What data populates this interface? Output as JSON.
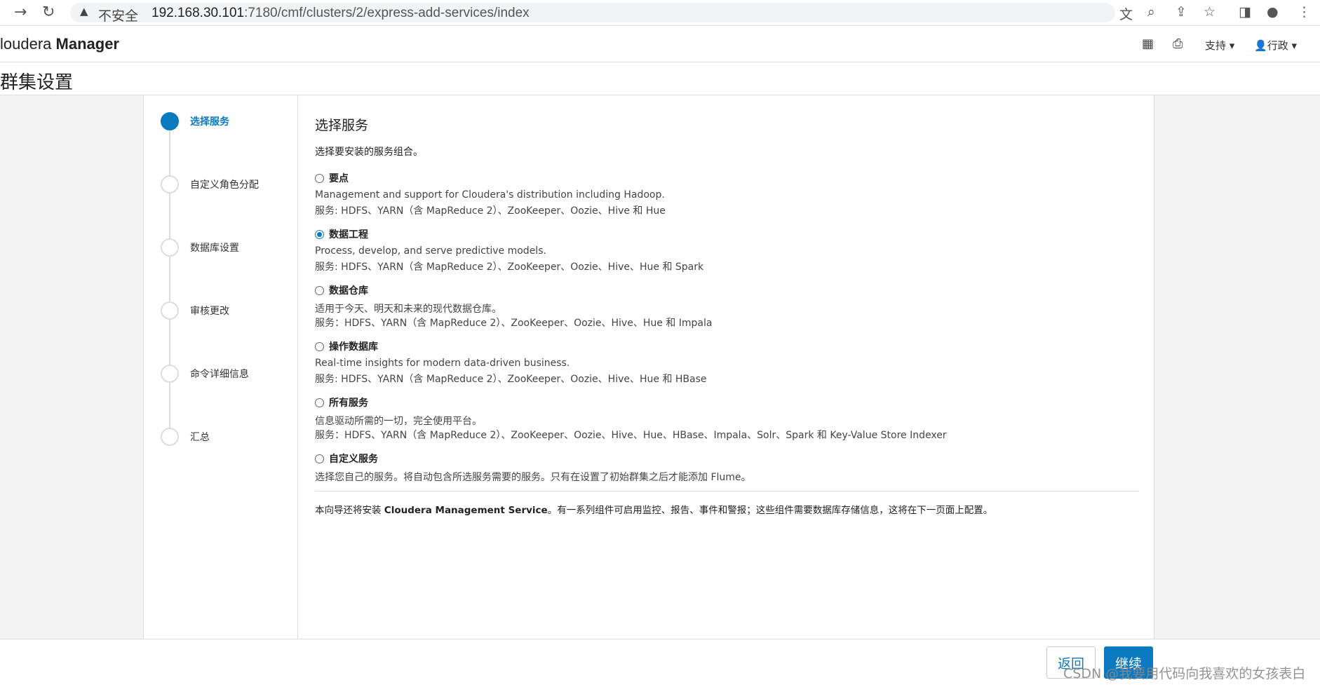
{
  "browser": {
    "insecure_label": "不安全",
    "url_host": "192.168.30.101",
    "url_path": ":7180/cmf/clusters/2/express-add-services/index"
  },
  "header": {
    "brand_light": "loudera ",
    "brand_strong": "Manager",
    "support_menu": "支持 ▾",
    "admin_menu": "行政 ▾"
  },
  "page": {
    "title": "群集设置"
  },
  "steps": [
    {
      "label": "选择服务",
      "active": true
    },
    {
      "label": "自定义角色分配",
      "active": false
    },
    {
      "label": "数据库设置",
      "active": false
    },
    {
      "label": "审核更改",
      "active": false
    },
    {
      "label": "命令详细信息",
      "active": false
    },
    {
      "label": "汇总",
      "active": false
    }
  ],
  "main": {
    "title": "选择服务",
    "description": "选择要安装的服务组合。",
    "options": [
      {
        "title": "要点",
        "checked": false,
        "desc": "Management and support for Cloudera's distribution including Hadoop.",
        "services": "服务: HDFS、YARN（含 MapReduce 2）、ZooKeeper、Oozie、Hive 和 Hue"
      },
      {
        "title": "数据工程",
        "checked": true,
        "desc": "Process, develop, and serve predictive models.",
        "services": "服务: HDFS、YARN（含 MapReduce 2）、ZooKeeper、Oozie、Hive、Hue 和 Spark"
      },
      {
        "title": "数据仓库",
        "checked": false,
        "desc": "适用于今天、明天和未来的现代数据仓库。",
        "services": "服务：HDFS、YARN（含 MapReduce 2）、ZooKeeper、Oozie、Hive、Hue 和 Impala"
      },
      {
        "title": "操作数据库",
        "checked": false,
        "desc": "Real-time insights for modern data-driven business.",
        "services": "服务: HDFS、YARN（含 MapReduce 2）、ZooKeeper、Oozie、Hive、Hue 和 HBase"
      },
      {
        "title": "所有服务",
        "checked": false,
        "desc": "信息驱动所需的一切，完全使用平台。",
        "services": "服务：HDFS、YARN（含 MapReduce 2）、ZooKeeper、Oozie、Hive、Hue、HBase、Impala、Solr、Spark 和 Key-Value Store Indexer"
      },
      {
        "title": "自定义服务",
        "checked": false,
        "desc": "选择您自己的服务。将自动包含所选服务需要的服务。只有在设置了初始群集之后才能添加 Flume。",
        "services": ""
      }
    ],
    "note_prefix": "本向导还将安装 ",
    "note_bold": "Cloudera Management Service",
    "note_suffix": "。有一系列组件可启用监控、报告、事件和警报；这些组件需要数据库存储信息，这将在下一页面上配置。"
  },
  "footer": {
    "back_label": "返回",
    "continue_label": "继续",
    "watermark": "CSDN @我要用代码向我喜欢的女孩表白"
  }
}
